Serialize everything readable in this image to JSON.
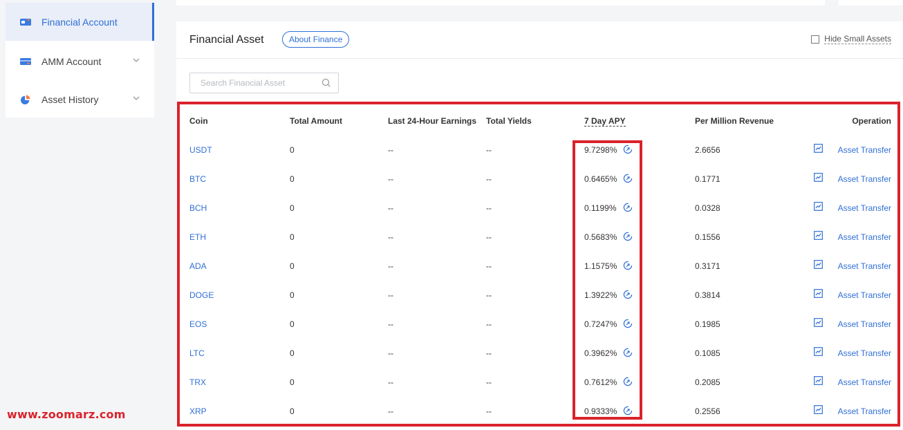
{
  "sidebar": {
    "items": [
      {
        "label": "Financial Account",
        "active": true,
        "icon": "wallet-card-icon"
      },
      {
        "label": "AMM Account",
        "active": false,
        "icon": "card-icon"
      },
      {
        "label": "Asset History",
        "active": false,
        "icon": "pie-chart-icon"
      }
    ]
  },
  "watermark": "www.zoomarz.com",
  "main": {
    "title": "Financial Asset",
    "about_label": "About Finance",
    "hide_small_label": "Hide Small Assets",
    "hide_small_checked": false,
    "search_placeholder": "Search Financial Asset",
    "table": {
      "headers": {
        "coin": "Coin",
        "total": "Total Amount",
        "last24": "Last 24-Hour Earnings",
        "yields": "Total Yields",
        "apy": "7 Day APY",
        "pmr": "Per Million Revenue",
        "operation": "Operation"
      },
      "rows": [
        {
          "coin": "USDT",
          "total": "0",
          "last24": "--",
          "yields": "--",
          "apy": "9.7298%",
          "pmr": "2.6656",
          "op": "Asset Transfer"
        },
        {
          "coin": "BTC",
          "total": "0",
          "last24": "--",
          "yields": "--",
          "apy": "0.6465%",
          "pmr": "0.1771",
          "op": "Asset Transfer"
        },
        {
          "coin": "BCH",
          "total": "0",
          "last24": "--",
          "yields": "--",
          "apy": "0.1199%",
          "pmr": "0.0328",
          "op": "Asset Transfer"
        },
        {
          "coin": "ETH",
          "total": "0",
          "last24": "--",
          "yields": "--",
          "apy": "0.5683%",
          "pmr": "0.1556",
          "op": "Asset Transfer"
        },
        {
          "coin": "ADA",
          "total": "0",
          "last24": "--",
          "yields": "--",
          "apy": "1.1575%",
          "pmr": "0.3171",
          "op": "Asset Transfer"
        },
        {
          "coin": "DOGE",
          "total": "0",
          "last24": "--",
          "yields": "--",
          "apy": "1.3922%",
          "pmr": "0.3814",
          "op": "Asset Transfer"
        },
        {
          "coin": "EOS",
          "total": "0",
          "last24": "--",
          "yields": "--",
          "apy": "0.7247%",
          "pmr": "0.1985",
          "op": "Asset Transfer"
        },
        {
          "coin": "LTC",
          "total": "0",
          "last24": "--",
          "yields": "--",
          "apy": "0.3962%",
          "pmr": "0.1085",
          "op": "Asset Transfer"
        },
        {
          "coin": "TRX",
          "total": "0",
          "last24": "--",
          "yields": "--",
          "apy": "0.7612%",
          "pmr": "0.2085",
          "op": "Asset Transfer"
        },
        {
          "coin": "XRP",
          "total": "0",
          "last24": "--",
          "yields": "--",
          "apy": "0.9333%",
          "pmr": "0.2556",
          "op": "Asset Transfer"
        }
      ]
    }
  },
  "colors": {
    "accent": "#2f6fd6",
    "highlight": "#d9232c",
    "sidebar_active_bg": "#e9eef8"
  }
}
